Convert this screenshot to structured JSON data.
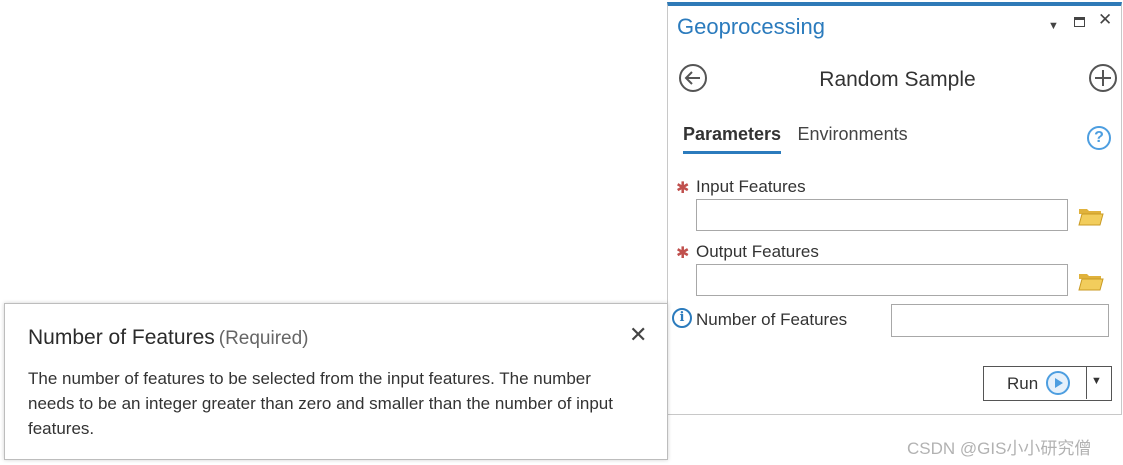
{
  "pane": {
    "title": "Geoprocessing",
    "tool_title": "Random Sample",
    "tabs": [
      {
        "label": "Parameters",
        "active": true
      },
      {
        "label": "Environments",
        "active": false
      }
    ],
    "params": {
      "input_features": {
        "label": "Input Features",
        "required": true,
        "value": ""
      },
      "output_features": {
        "label": "Output Features",
        "required": true,
        "value": ""
      },
      "number_of_features": {
        "label": "Number of Features",
        "value": ""
      }
    },
    "run_label": "Run",
    "icons": {
      "back": "back-arrow-icon",
      "add": "add-icon",
      "help": "help-icon",
      "folder": "folder-icon",
      "info": "info-icon",
      "play": "play-icon"
    },
    "accent_color": "#2b7bbd",
    "required_color": "#c0504d"
  },
  "popup": {
    "title": "Number of Features",
    "subtitle": "(Required)",
    "body": "The number of features to be selected from the input features. The number needs to be an integer greater than zero and smaller than the number of input features."
  },
  "watermark": "CSDN @GIS小小研究僧"
}
